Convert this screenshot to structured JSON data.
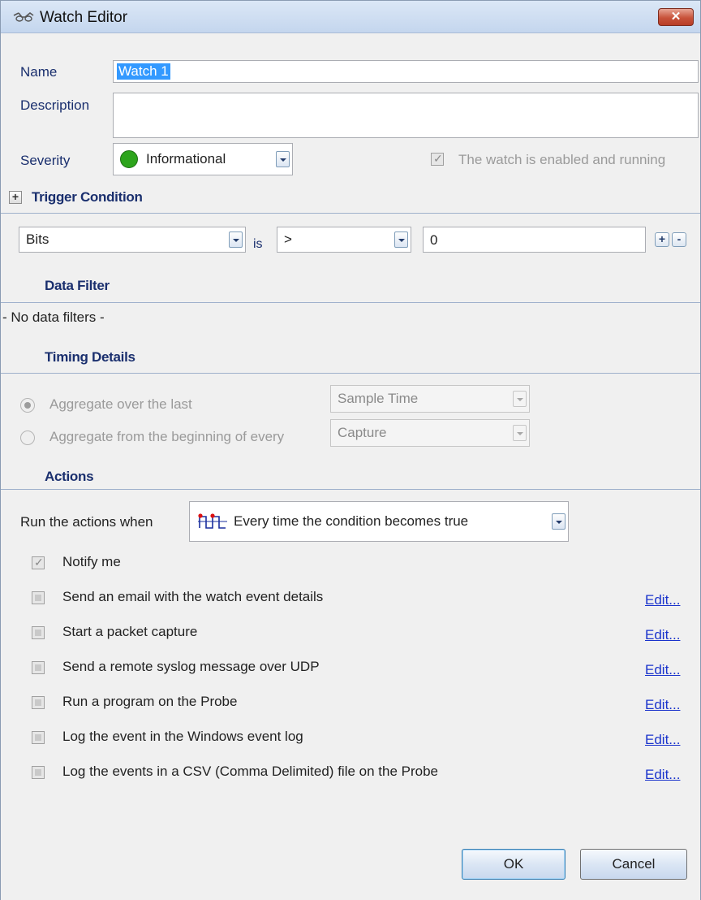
{
  "window": {
    "title": "Watch Editor",
    "close_label": "✕"
  },
  "fields": {
    "name_label": "Name",
    "name_value": "Watch 1",
    "description_label": "Description",
    "description_value": "",
    "severity_label": "Severity",
    "severity_value": "Informational",
    "severity_color": "#2da41c",
    "enabled_label": "The watch is enabled and running",
    "enabled_checked": true
  },
  "trigger": {
    "title": "Trigger Condition",
    "metric": "Bits",
    "is_label": "is",
    "operator": ">",
    "value": "0",
    "add_label": "+",
    "remove_label": "-"
  },
  "data_filter": {
    "title": "Data Filter",
    "empty_text": "- No data filters -"
  },
  "timing": {
    "title": "Timing Details",
    "option1_label": "Aggregate over the last",
    "option1_value": "Sample Time",
    "option2_label": "Aggregate from the beginning of every",
    "option2_value": "Capture",
    "selected": "option1"
  },
  "actions": {
    "title": "Actions",
    "run_label": "Run the actions when",
    "run_value": "Every time the condition becomes true",
    "notify_label": "Notify me",
    "edit_label": "Edit...",
    "items": [
      {
        "label": "Send an email with the watch event details",
        "checked": false
      },
      {
        "label": "Start a packet capture",
        "checked": false
      },
      {
        "label": "Send a remote syslog message over UDP",
        "checked": false
      },
      {
        "label": "Run a program on the Probe",
        "checked": false
      },
      {
        "label": "Log the event in the Windows event log",
        "checked": false
      },
      {
        "label": "Log the events in a CSV (Comma Delimited) file on the Probe",
        "checked": false
      }
    ]
  },
  "buttons": {
    "ok": "OK",
    "cancel": "Cancel"
  },
  "colors": {
    "section_text": "#1a2f6e",
    "link": "#1a33cc",
    "selection": "#3399ff"
  }
}
